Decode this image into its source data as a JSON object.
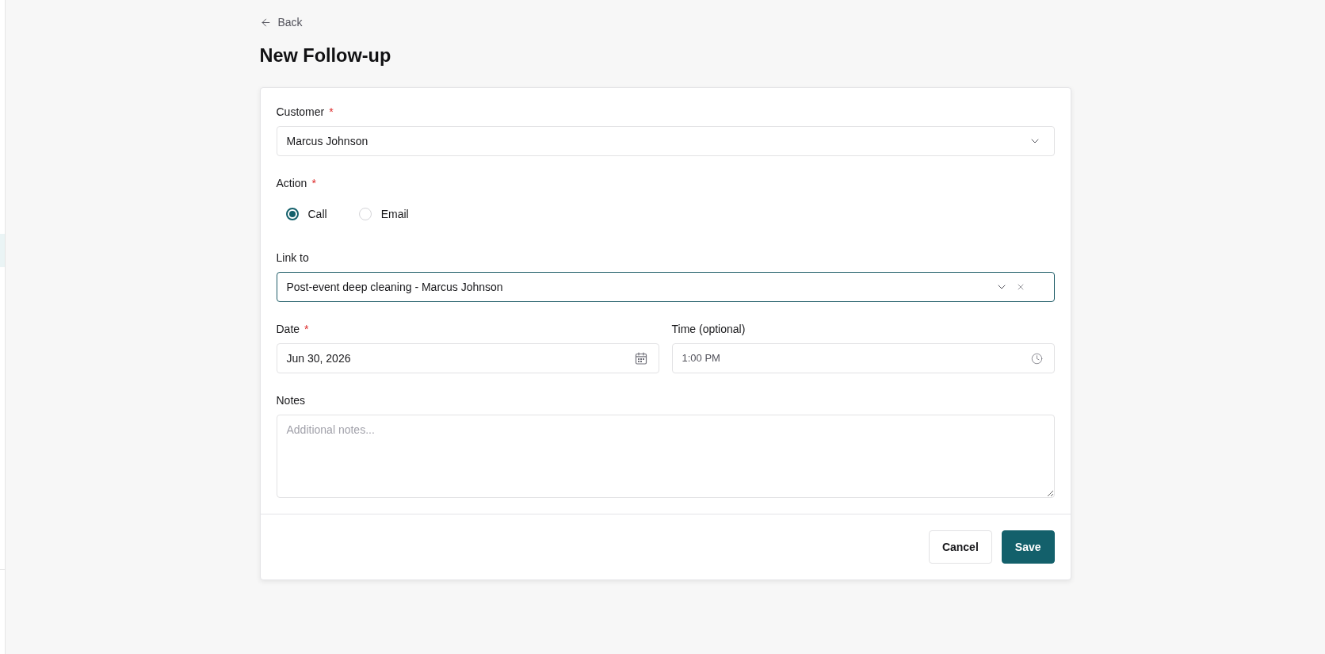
{
  "back_link": {
    "label": "Back"
  },
  "page_title": "New Follow-up",
  "form": {
    "fields": [
      {
        "kind": "select",
        "label": "Customer",
        "required_mark": "*",
        "value": "Marcus Johnson",
        "focused": false,
        "clearable": false
      },
      {
        "kind": "radio",
        "label": "Action",
        "required_mark": "*",
        "options": [
          {
            "label": "Call",
            "selected": true
          },
          {
            "label": "Email",
            "selected": false
          }
        ]
      },
      {
        "kind": "select",
        "label": "Link to",
        "value": "Post-event deep cleaning - Marcus Johnson",
        "focused": true,
        "clearable": true
      },
      {
        "kind": "row",
        "fields": [
          {
            "kind": "date",
            "label": "Date",
            "required_mark": "*",
            "value": "Jun 30, 2026"
          },
          {
            "kind": "time",
            "label": "Time (optional)",
            "value": "1:00 PM"
          }
        ]
      },
      {
        "kind": "textarea",
        "label": "Notes",
        "placeholder": "Additional notes..."
      }
    ]
  },
  "buttons": [
    {
      "kind": "cancel",
      "label": "Cancel"
    },
    {
      "kind": "save",
      "label": "Save"
    }
  ]
}
